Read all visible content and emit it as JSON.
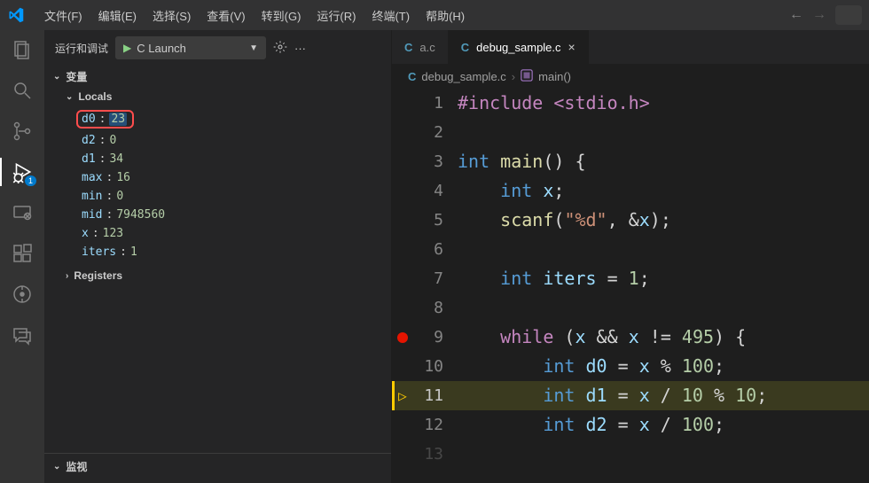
{
  "menubar": [
    "文件(F)",
    "编辑(E)",
    "选择(S)",
    "查看(V)",
    "转到(G)",
    "运行(R)",
    "终端(T)",
    "帮助(H)"
  ],
  "activity_badge": "1",
  "sidebar": {
    "title": "运行和调试",
    "launch_config": "C Launch",
    "sections": {
      "variables": "变量",
      "locals": "Locals",
      "registers": "Registers",
      "watch": "监视"
    },
    "locals": [
      {
        "name": "d0",
        "val": "23",
        "highlight": true
      },
      {
        "name": "d2",
        "val": "0"
      },
      {
        "name": "d1",
        "val": "34"
      },
      {
        "name": "max",
        "val": "16"
      },
      {
        "name": "min",
        "val": "0"
      },
      {
        "name": "mid",
        "val": "7948560"
      },
      {
        "name": "x",
        "val": "123"
      },
      {
        "name": "iters",
        "val": "1"
      }
    ]
  },
  "tabs": [
    {
      "name": "a.c",
      "active": false
    },
    {
      "name": "debug_sample.c",
      "active": true
    }
  ],
  "breadcrumb": {
    "file": "debug_sample.c",
    "func": "main()"
  },
  "code": {
    "breakpoint_line": 9,
    "current_line": 11,
    "lines": {
      "1": "#include <stdio.h>",
      "3a": "int ",
      "3b": "main",
      "3c": "() {",
      "4a": "    int ",
      "4b": "x",
      "4c": ";",
      "5a": "    ",
      "5b": "scanf",
      "5c": "(",
      "5d": "\"%d\"",
      "5e": ", &",
      "5f": "x",
      "5g": ");",
      "7a": "    int ",
      "7b": "iters",
      "7c": " = ",
      "7d": "1",
      "7e": ";",
      "9a": "    while ",
      "9b": "(",
      "9c": "x",
      "9d": " && ",
      "9e": "x",
      "9f": " != ",
      "9g": "495",
      "9h": ") {",
      "10a": "        int ",
      "10b": "d0",
      "10c": " = ",
      "10d": "x",
      "10e": " % ",
      "10f": "100",
      "10g": ";",
      "11a": "        int ",
      "11b": "d1",
      "11c": " = ",
      "11d": "x",
      "11e": " / ",
      "11f": "10",
      "11g": " % ",
      "11h": "10",
      "11i": ";",
      "12a": "        int ",
      "12b": "d2",
      "12c": " = ",
      "12d": "x",
      "12e": " / ",
      "12f": "100",
      "12g": ";"
    }
  }
}
